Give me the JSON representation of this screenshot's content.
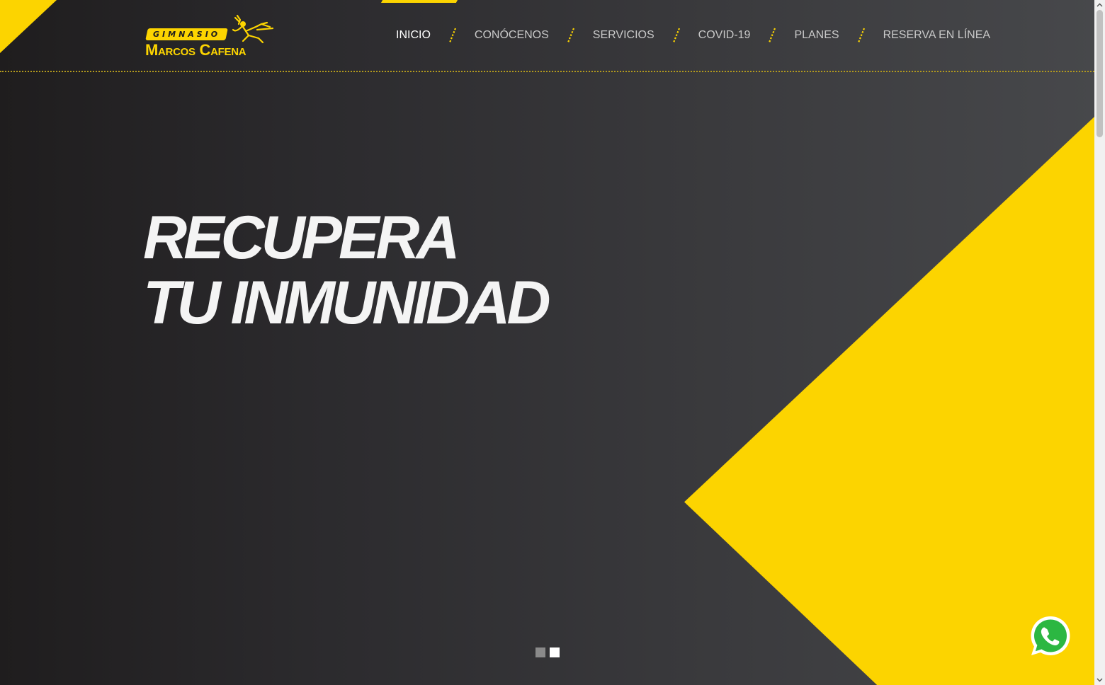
{
  "brand": {
    "badge_text": "GIMNASIO",
    "name": "Marcos Cafena",
    "color": "#fcd400"
  },
  "nav": {
    "items": [
      {
        "label": "INICIO",
        "active": true
      },
      {
        "label": "CONÓCENOS",
        "active": false
      },
      {
        "label": "SERVICIOS",
        "active": false
      },
      {
        "label": "COVID-19",
        "active": false
      },
      {
        "label": "PLANES",
        "active": false
      },
      {
        "label": "RESERVA EN LÍNEA",
        "active": false
      }
    ]
  },
  "hero": {
    "line1": "RECUPERA",
    "line2": "TU INMUNIDAD"
  },
  "slider": {
    "total": 2,
    "active_index": 2
  },
  "whatsapp": {
    "icon": "whatsapp-icon",
    "color": "#2cb742"
  },
  "colors": {
    "accent": "#fcd400",
    "background": "#2c2b2e"
  }
}
